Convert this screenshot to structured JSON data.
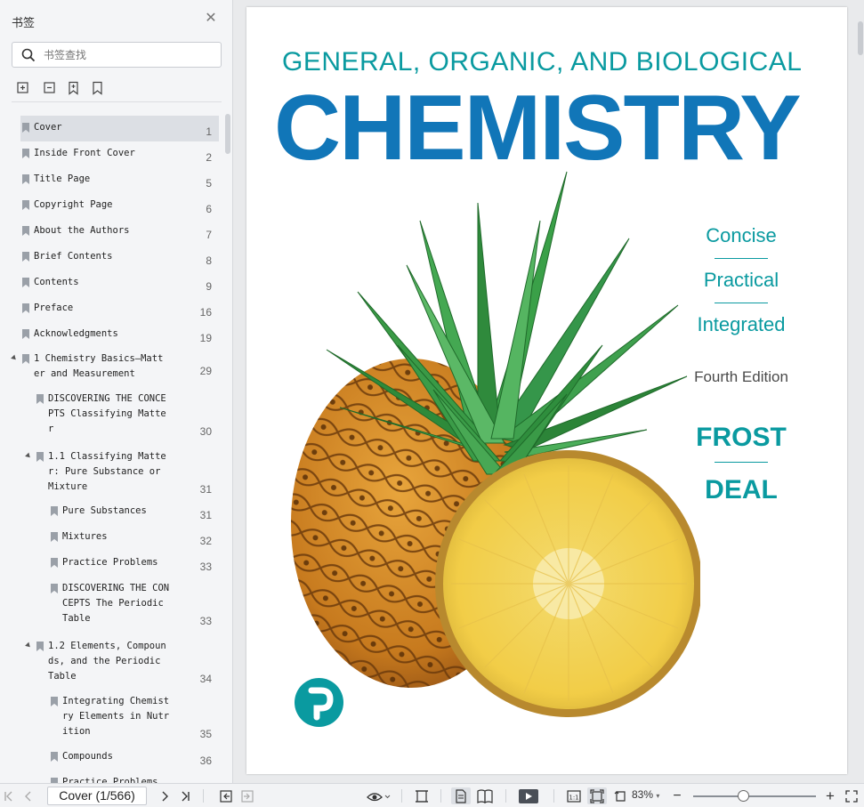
{
  "sidebar": {
    "title": "书签",
    "close_icon": "close-icon",
    "search_placeholder": "书签查找",
    "tools": [
      "expand-all-icon",
      "collapse-all-icon",
      "add-bookmark-icon",
      "bookmark-icon"
    ],
    "items": [
      {
        "label": "Cover",
        "page": "1",
        "level": 0,
        "selected": true
      },
      {
        "label": "Inside Front Cover",
        "page": "2",
        "level": 0
      },
      {
        "label": "Title Page",
        "page": "5",
        "level": 0
      },
      {
        "label": "Copyright Page",
        "page": "6",
        "level": 0
      },
      {
        "label": "About the Authors",
        "page": "7",
        "level": 0
      },
      {
        "label": "Brief Contents",
        "page": "8",
        "level": 0
      },
      {
        "label": "Contents",
        "page": "9",
        "level": 0
      },
      {
        "label": "Preface",
        "page": "16",
        "level": 0
      },
      {
        "label": "Acknowledgments",
        "page": "19",
        "level": 0
      },
      {
        "label": "1 Chemistry Basics—Matt\ner and Measurement",
        "page": "29",
        "level": 0,
        "expanded": true
      },
      {
        "label": "DISCOVERING THE CONCE\nPTS Classifying Matte\nr",
        "page": "30",
        "level": 1
      },
      {
        "label": "1.1 Classifying Matte\nr: Pure Substance or\nMixture",
        "page": "31",
        "level": 1,
        "expanded": true
      },
      {
        "label": "Pure Substances",
        "page": "31",
        "level": 2
      },
      {
        "label": "Mixtures",
        "page": "32",
        "level": 2
      },
      {
        "label": "Practice Problems",
        "page": "33",
        "level": 2
      },
      {
        "label": "DISCOVERING THE CON\nCEPTS The Periodic\nTable",
        "page": "33",
        "level": 2
      },
      {
        "label": "1.2 Elements, Compoun\nds, and the Periodic\nTable",
        "page": "34",
        "level": 1,
        "expanded": true
      },
      {
        "label": "Integrating Chemist\nry Elements in Nutr\nition",
        "page": "35",
        "level": 2
      },
      {
        "label": "Compounds",
        "page": "36",
        "level": 2
      },
      {
        "label": "Practice Problems",
        "page": "",
        "level": 2
      }
    ]
  },
  "cover": {
    "top_line": "GENERAL, ORGANIC, AND BIOLOGICAL",
    "title": "CHEMISTRY",
    "taglines": [
      "Concise",
      "Practical",
      "Integrated"
    ],
    "edition": "Fourth Edition",
    "authors": [
      "FROST",
      "DEAL"
    ],
    "publisher_logo": "pearson-logo",
    "colors": {
      "teal": "#0a9aa0",
      "blue": "#1176b8"
    }
  },
  "toolbar": {
    "page_field": "Cover (1/566)",
    "zoom": "83%"
  }
}
